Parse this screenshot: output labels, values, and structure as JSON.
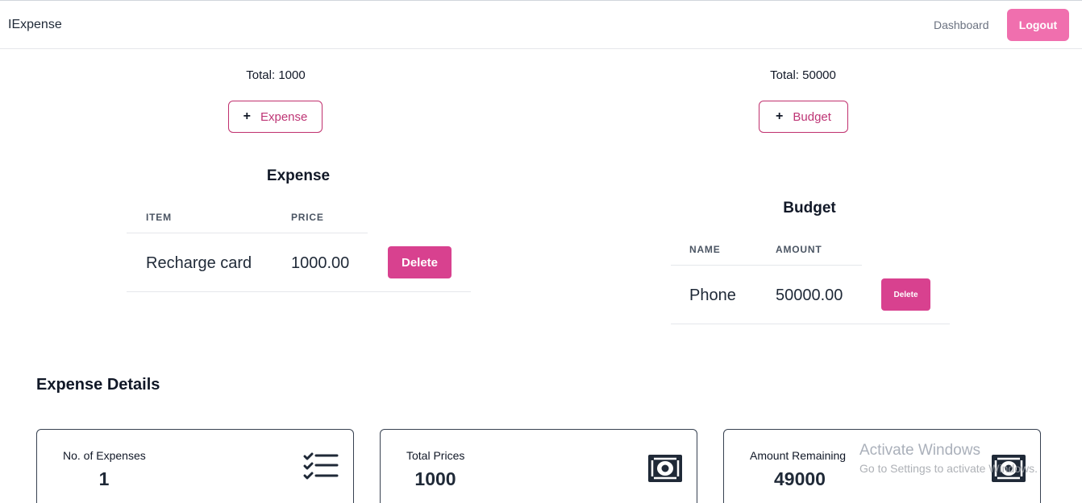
{
  "navbar": {
    "brand": "IExpense",
    "dashboard_link": "Dashboard",
    "logout_label": "Logout"
  },
  "expense_panel": {
    "total_text": "Total: 1000",
    "add_label": "Expense",
    "add_icon": "plus-icon",
    "title": "Expense",
    "columns": [
      "ITEM",
      "PRICE"
    ],
    "rows": [
      {
        "item": "Recharge card",
        "price": "1000.00",
        "delete_label": "Delete"
      }
    ]
  },
  "budget_panel": {
    "total_text": "Total: 50000",
    "add_label": "Budget",
    "add_icon": "plus-icon",
    "title": "Budget",
    "columns": [
      "NAME",
      "AMOUNT"
    ],
    "rows": [
      {
        "name": "Phone",
        "amount": "50000.00",
        "delete_label": "Delete"
      }
    ]
  },
  "details": {
    "title": "Expense Details",
    "cards": [
      {
        "label": "No. of Expenses",
        "value": "1",
        "icon": "checklist-icon"
      },
      {
        "label": "Total Prices",
        "value": "1000",
        "icon": "money-icon"
      },
      {
        "label": "Amount Remaining",
        "value": "49000",
        "icon": "money-icon"
      }
    ]
  },
  "watermark": {
    "title": "Activate Windows",
    "subtitle": "Go to Settings to activate Windows."
  },
  "colors": {
    "accent": "#f06fae",
    "delete": "#d8418f",
    "outline": "#c0306e"
  }
}
